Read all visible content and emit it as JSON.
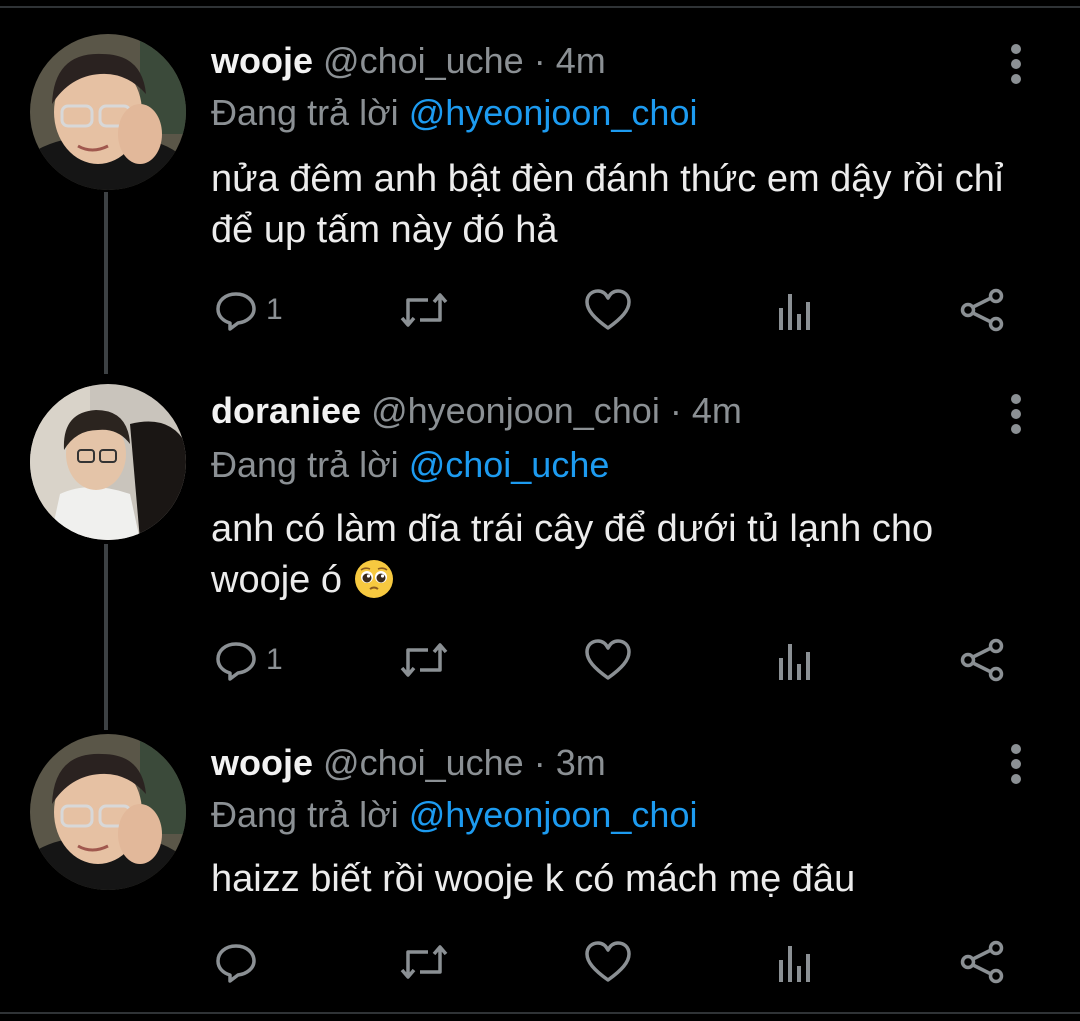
{
  "tweets": [
    {
      "name": "wooje",
      "handle": "@choi_uche",
      "separator": "·",
      "time": "4m",
      "reply_prefix": "Đang trả lời",
      "reply_to": "@hyeonjoon_choi",
      "text": "nửa đêm anh bật đèn đánh thức em dậy rồi chỉ để up tấm này đó hả",
      "reply_count": "1",
      "avatar": "wooje-avatar"
    },
    {
      "name": "doraniee",
      "handle": "@hyeonjoon_choi",
      "separator": "·",
      "time": "4m",
      "reply_prefix": "Đang trả lời",
      "reply_to": "@choi_uche",
      "text": "anh có làm dĩa trái cây để dưới tủ lạnh cho wooje ó",
      "emoji": "pleading-face",
      "reply_count": "1",
      "avatar": "doraniee-avatar"
    },
    {
      "name": "wooje",
      "handle": "@choi_uche",
      "separator": "·",
      "time": "3m",
      "reply_prefix": "Đang trả lời",
      "reply_to": "@hyeonjoon_choi",
      "text": "haizz biết rồi wooje k có mách mẹ đâu",
      "reply_count": "",
      "avatar": "wooje-avatar"
    }
  ],
  "icons": [
    "reply-icon",
    "retweet-icon",
    "like-icon",
    "analytics-icon",
    "share-icon",
    "more-icon"
  ],
  "colors": {
    "background": "#000000",
    "mention": "#1d9bf0",
    "muted": "#8b9094",
    "text": "#ececec"
  }
}
